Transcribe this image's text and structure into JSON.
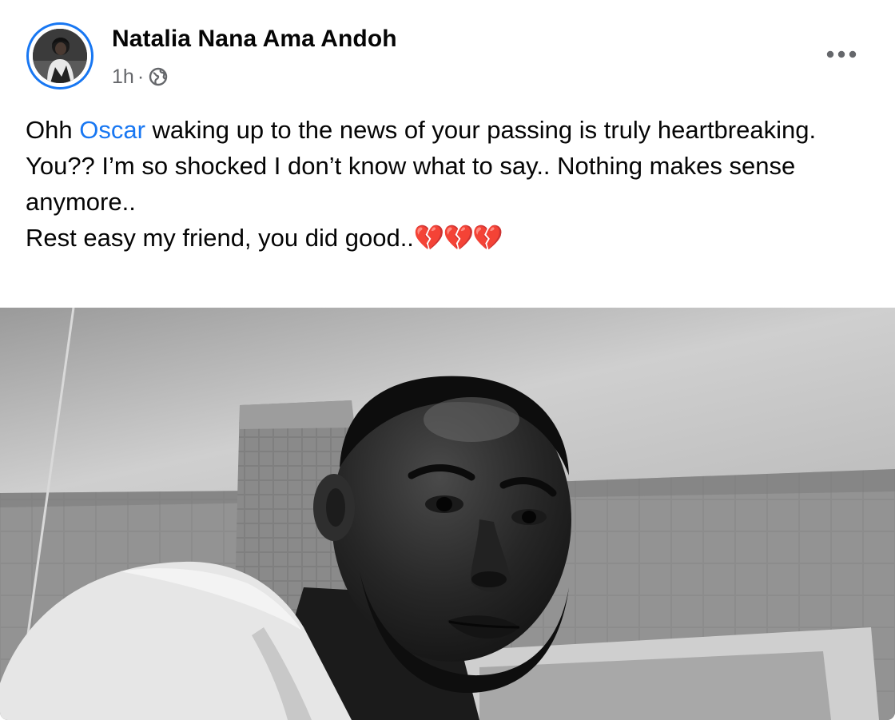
{
  "post": {
    "author_name": "Natalia Nana Ama Andoh",
    "timestamp": "1h",
    "separator": "·",
    "privacy_icon": "globe-icon",
    "more_icon": "more-options-icon",
    "mention_color": "#1877f2",
    "text": {
      "line1_prefix": "Ohh ",
      "line1_mention": "Oscar",
      "line1_suffix": " waking up to the news of your passing is truly heartbreaking.",
      "line2": "You?? I’m so shocked I don’t know what to say.. Nothing makes sense anymore..",
      "line3_text": "Rest easy my friend, you did good..",
      "line3_emoji": "💔💔💔"
    }
  }
}
